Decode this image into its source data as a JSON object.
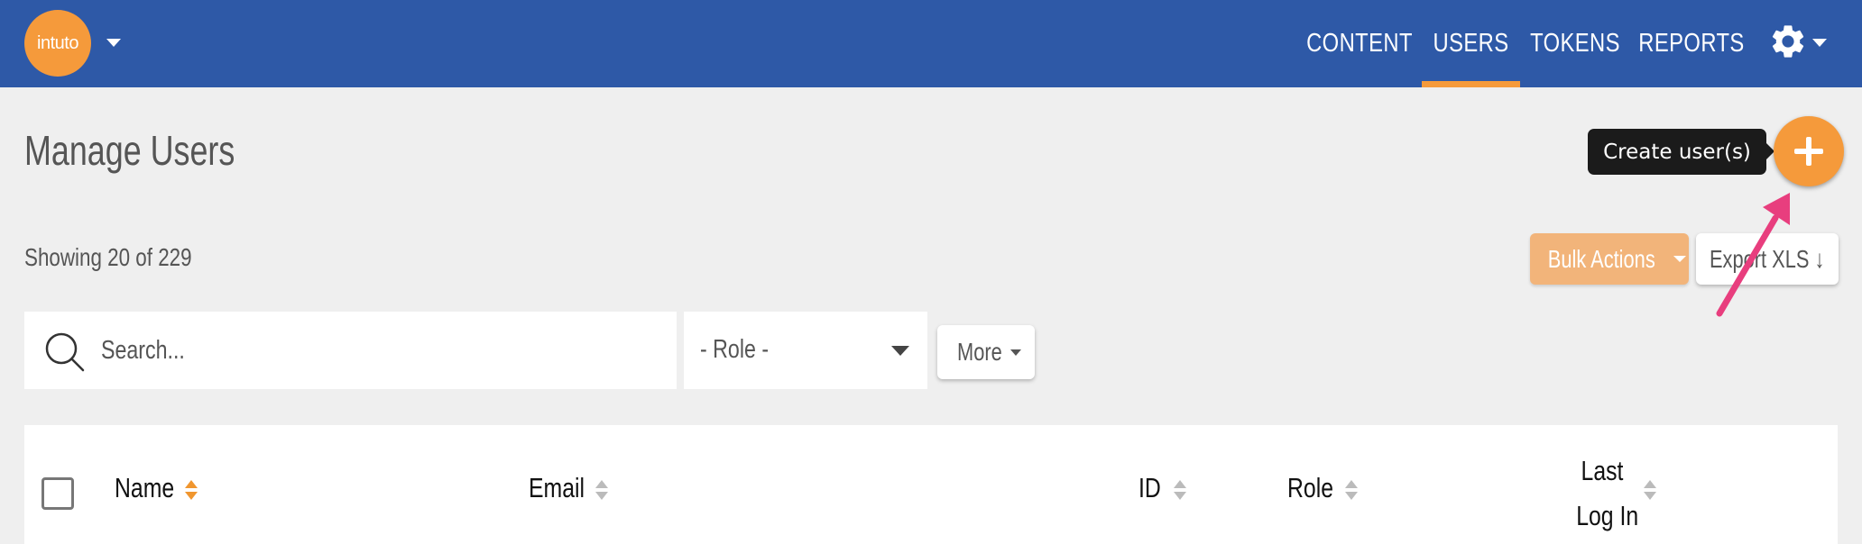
{
  "app": {
    "logo_text": "intuto"
  },
  "nav": {
    "items": [
      {
        "label": "CONTENT"
      },
      {
        "label": "USERS"
      },
      {
        "label": "TOKENS"
      },
      {
        "label": "REPORTS"
      }
    ],
    "active": "USERS"
  },
  "page": {
    "title": "Manage Users",
    "create_tooltip": "Create user(s)",
    "showing": "Showing 20 of 229"
  },
  "toolbar": {
    "bulk_actions_label": "Bulk Actions",
    "export_label": "Export XLS ↓"
  },
  "filters": {
    "search_placeholder": "Search...",
    "role_value": "- Role -",
    "more_label": "More"
  },
  "table": {
    "columns": [
      {
        "label": "Name",
        "sorted": true
      },
      {
        "label": "Email",
        "sorted": false
      },
      {
        "label": "ID",
        "sorted": false
      },
      {
        "label": "Role",
        "sorted": false
      },
      {
        "label_line1": "Last",
        "label_line2": "Log In",
        "sorted": false
      }
    ]
  },
  "colors": {
    "header_bg": "#2e59a7",
    "accent": "#f59a3b",
    "page_bg": "#efefef",
    "annotation_arrow": "#e83e7e"
  }
}
